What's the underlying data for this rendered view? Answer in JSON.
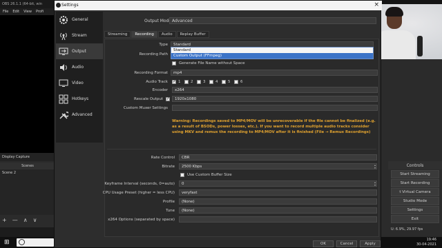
{
  "obs": {
    "title": "OBS 26.1.1 (64-bit, win",
    "menu": [
      "File",
      "Edit",
      "View",
      "Profi"
    ],
    "display_capture": "Display Capture",
    "scenes_header": "Scenes",
    "scene_item": "Scene 2",
    "scene_tools": [
      "+",
      "—",
      "∧",
      "∨"
    ],
    "controls_header": "Controls",
    "controls": [
      "Start Streaming",
      "Start Recording",
      "t Virtual Camera",
      "Studio Mode",
      "Settings",
      "Exit"
    ],
    "stats": "U: 6.9%, 29.97 fps"
  },
  "taskbar": {
    "time": "19:46",
    "date": "30-04-2021"
  },
  "dialog": {
    "title": "Settings",
    "nav": [
      {
        "label": "General",
        "icon": "gear-icon"
      },
      {
        "label": "Stream",
        "icon": "antenna-icon"
      },
      {
        "label": "Output",
        "icon": "monitor-output-icon"
      },
      {
        "label": "Audio",
        "icon": "speaker-icon"
      },
      {
        "label": "Video",
        "icon": "display-icon"
      },
      {
        "label": "Hotkeys",
        "icon": "keyboard-icon"
      },
      {
        "label": "Advanced",
        "icon": "tools-icon"
      }
    ],
    "output_mode_label": "Output Mode",
    "output_mode_value": "Advanced",
    "tabs": [
      "Streaming",
      "Recording",
      "Audio",
      "Replay Buffer"
    ],
    "active_tab": "Recording",
    "type_label": "Type",
    "type_value": "Standard",
    "type_options": [
      "Standard",
      "Custom Output (FFmpeg)"
    ],
    "recording_path_label": "Recording Path",
    "generate_filename_label": "Generate File Name without Space",
    "recording_format_label": "Recording Format",
    "recording_format_value": "mp4",
    "audio_track_label": "Audio Track",
    "audio_tracks": [
      "1",
      "2",
      "3",
      "4",
      "5",
      "6"
    ],
    "encoder_label": "Encoder",
    "encoder_value": "x264",
    "rescale_label": "Rescale Output",
    "rescale_value": "1920x1080",
    "muxer_label": "Custom Muxer Settings",
    "warning": "Warning: Recordings saved to MP4/MOV will be unrecoverable if the file cannot be finalized (e.g. as a result of BSODs, power losses, etc.). If you want to record multiple audio tracks consider using MKV and remux the recording to MP4/MOV after it is finished (File → Remux Recordings)",
    "rate_control_label": "Rate Control",
    "rate_control_value": "CBR",
    "bitrate_label": "Bitrate",
    "bitrate_value": "2500 Kbps",
    "custom_buffer_label": "Use Custom Buffer Size",
    "keyframe_label": "Keyframe Interval (seconds, 0=auto)",
    "keyframe_value": "0",
    "preset_label": "CPU Usage Preset (higher = less CPU)",
    "preset_value": "veryfast",
    "profile_label": "Profile",
    "profile_value": "(None)",
    "tune_label": "Tune",
    "tune_value": "(None)",
    "x264_options_label": "x264 Options (separated by space)",
    "x264_options_value": "",
    "buttons": {
      "ok": "OK",
      "cancel": "Cancel",
      "apply": "Apply"
    }
  }
}
